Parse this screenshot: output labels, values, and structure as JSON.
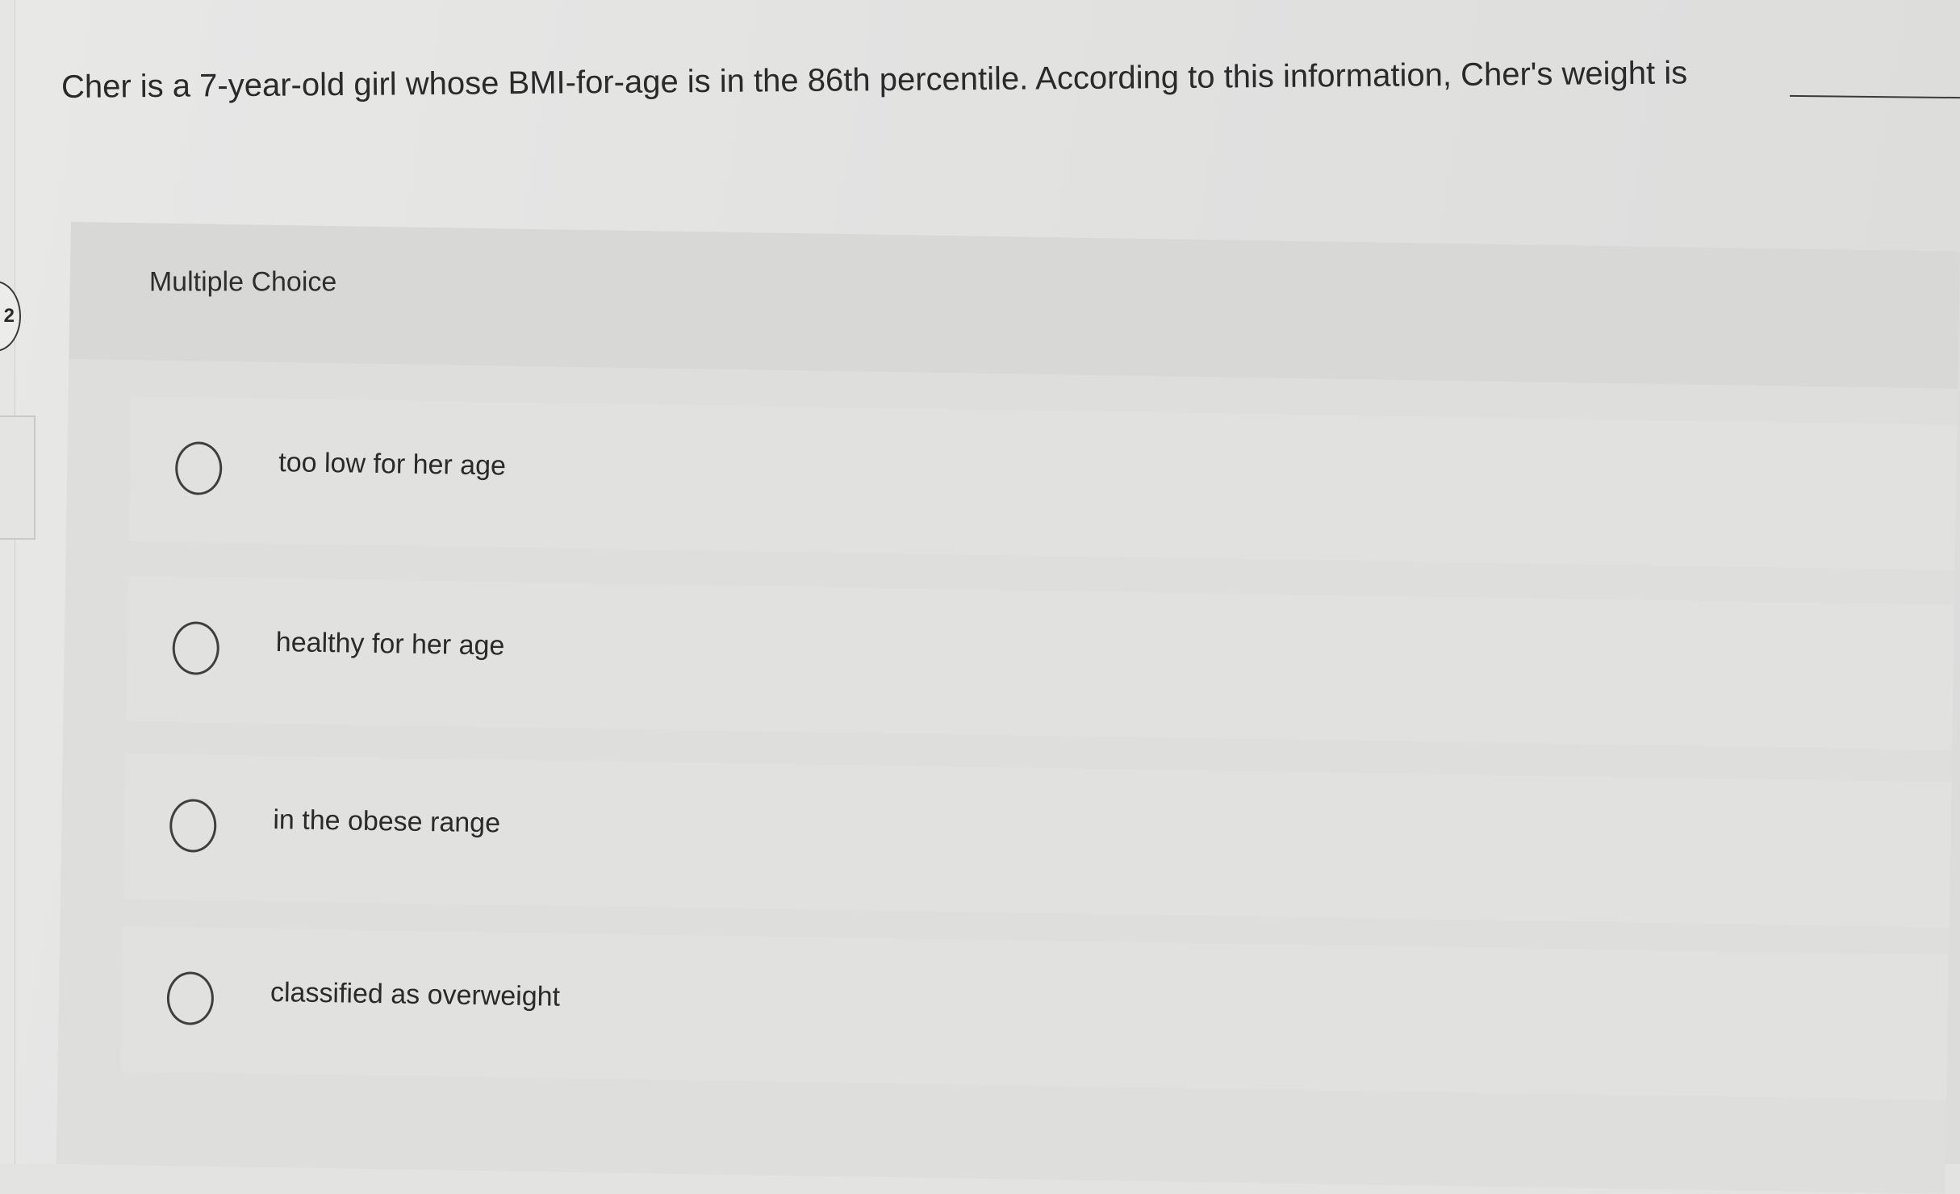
{
  "question": {
    "number": "2",
    "text": "Cher is a 7-year-old girl whose BMI-for-age is in the 86th percentile. According to this information, Cher's weight is"
  },
  "multiple_choice": {
    "label": "Multiple Choice",
    "options": [
      {
        "label": "too low for her age",
        "selected": false
      },
      {
        "label": "healthy for her age",
        "selected": false
      },
      {
        "label": "in the obese range",
        "selected": false
      },
      {
        "label": "classified as overweight",
        "selected": false
      }
    ]
  },
  "colors": {
    "background": "#e3e3e2",
    "panel": "#dededd",
    "text": "#2a2a2a",
    "radio_border": "#3f3f3f"
  }
}
